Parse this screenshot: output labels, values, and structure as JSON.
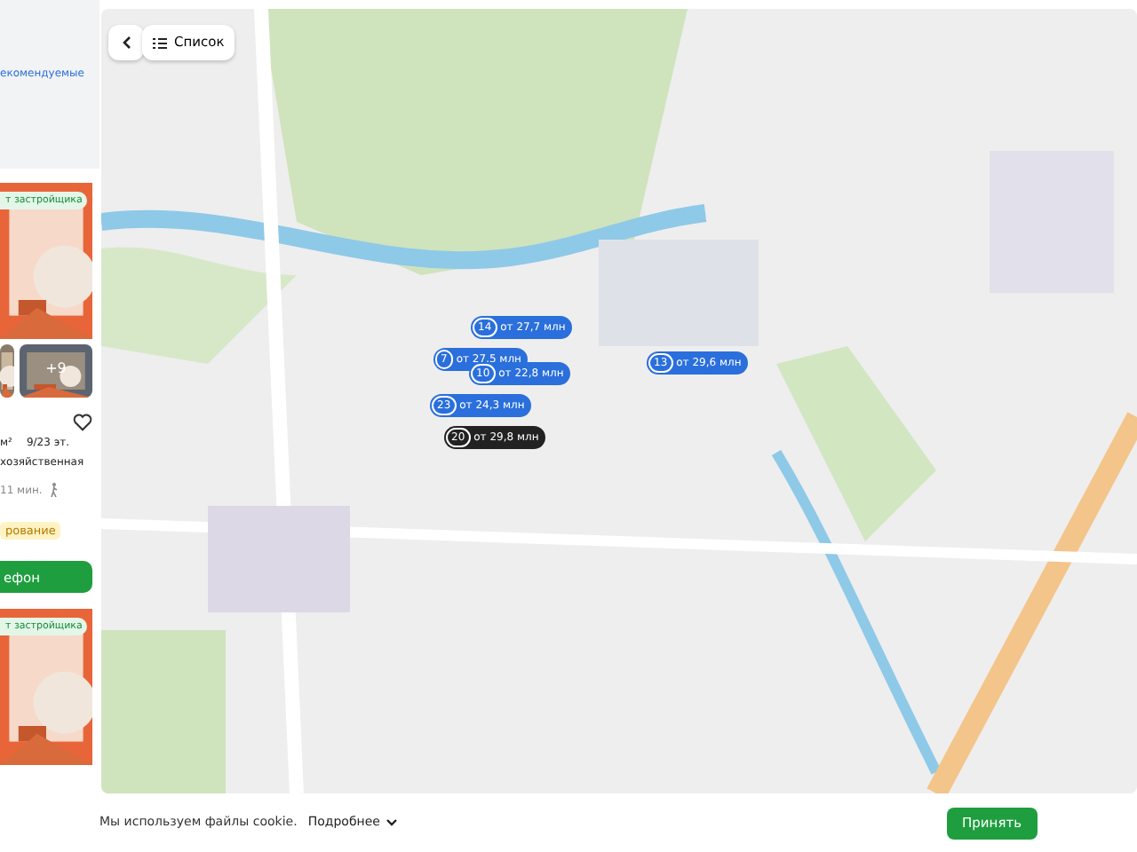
{
  "sidebar": {
    "recommended_link": "екомендуемые",
    "listings": [
      {
        "badge": "т застройщика",
        "photo_more": "+9",
        "area": "м²",
        "floor": "9/23 эт.",
        "address": "хозяйственная",
        "walk_time": "11 мин.",
        "tag": "рование",
        "call_button": "ефон"
      },
      {
        "badge": "т застройщика"
      }
    ]
  },
  "map": {
    "list_button": "Список",
    "markers": [
      {
        "count": "14",
        "price": "от 27,7 млн",
        "selected": false
      },
      {
        "count": "7",
        "price": "от 27,5 млн",
        "selected": false
      },
      {
        "count": "10",
        "price": "от 22,8 млн",
        "selected": false
      },
      {
        "count": "13",
        "price": "от 29,6 млн",
        "selected": false
      },
      {
        "count": "23",
        "price": "от 24,3 млн",
        "selected": false
      },
      {
        "count": "20",
        "price": "от 29,8 млн",
        "selected": true
      }
    ]
  },
  "cookie_bar": {
    "text": "Мы используем файлы cookie.",
    "more_link": "Подробнее",
    "accept_button": "Принять"
  }
}
